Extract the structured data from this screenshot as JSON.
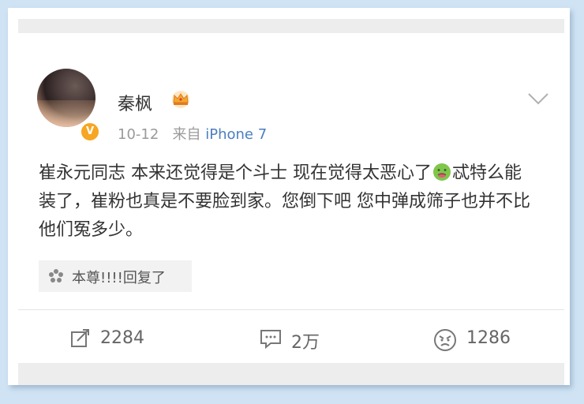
{
  "post": {
    "username": "秦枫",
    "date": "10-12",
    "source_prefix": "来自",
    "source": "iPhone 7",
    "content_part1": "崔永元同志 本来还觉得是个斗士 现在觉得太恶心了",
    "content_part2": "忒特么能装了，崔粉也真是不要脸到家。您倒下吧 您中弹成筛子也并不比他们冤多少。",
    "reply": "本尊!!!!回复了"
  },
  "actions": {
    "repost_count": "2284",
    "comment_count": "2万",
    "like_count": "1286"
  },
  "icons": {
    "crown": "crown-badge-icon",
    "verified": "verified-badge-icon",
    "chevron": "chevron-down-icon",
    "emoji": "nauseated-face-emoji",
    "reply": "flower-icon",
    "repost": "repost-icon",
    "comment": "comment-icon",
    "like": "angry-face-icon"
  },
  "colors": {
    "frame": "#cfe3f4",
    "source_link": "#4a7fbf",
    "verified": "#f6a623",
    "text": "#333333"
  }
}
